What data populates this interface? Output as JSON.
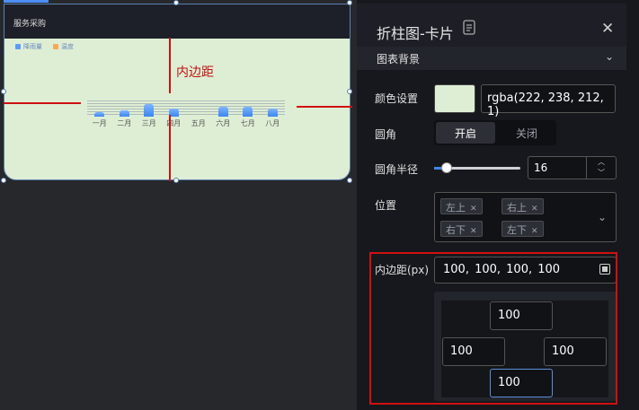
{
  "canvas": {
    "card_title": "服务采购",
    "legend": [
      {
        "label": "降雨量",
        "color": "#5b9bf7"
      },
      {
        "label": "温度",
        "color": "#f5a95a"
      }
    ],
    "padding_annotation": "内边距",
    "background_color": "#deeed4"
  },
  "chart_data": {
    "type": "bar",
    "categories": [
      "一月",
      "二月",
      "三月",
      "四月",
      "五月",
      "六月",
      "七月",
      "八月"
    ],
    "series": [
      {
        "name": "降雨量",
        "values": [
          3,
          4,
          8,
          5,
          0,
          6,
          6,
          5
        ]
      }
    ],
    "ylim": [
      0,
      10
    ]
  },
  "panel": {
    "title": "折柱图-卡片",
    "section": "图表背景",
    "color_label": "颜色设置",
    "color_value": "rgba(222, 238, 212, 1)",
    "radius_label": "圆角",
    "toggle_on": "开启",
    "toggle_off": "关闭",
    "radius_size_label": "圆角半径",
    "radius_value": "16",
    "position_label": "位置",
    "positions": [
      "左上",
      "右上",
      "右下",
      "左下"
    ],
    "padding_label": "内边距(px)",
    "padding_value": "100,  100,  100,  100",
    "padding_top": "100",
    "padding_left": "100",
    "padding_right": "100",
    "padding_bottom": "100"
  }
}
